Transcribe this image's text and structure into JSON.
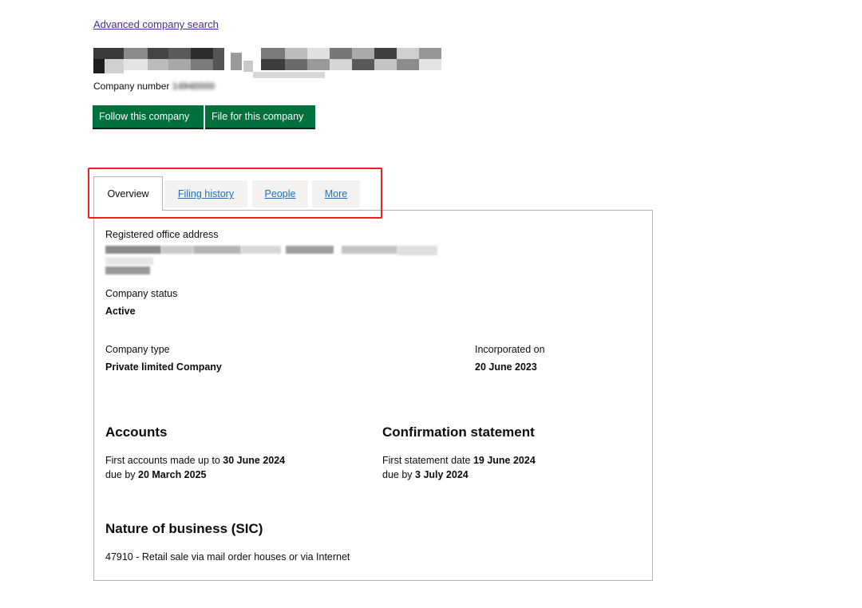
{
  "header": {
    "advanced_search_link": "Advanced company search",
    "company_number_label": "Company number",
    "company_number_value": "14940000"
  },
  "actions": {
    "follow_label": "Follow this company",
    "file_label": "File for this company",
    "button_color": "#00703c"
  },
  "tabs": [
    {
      "label": "Overview",
      "selected": true
    },
    {
      "label": "Filing history",
      "selected": false
    },
    {
      "label": "People",
      "selected": false
    },
    {
      "label": "More",
      "selected": false
    }
  ],
  "overview": {
    "registered_office_label": "Registered office address",
    "status_label": "Company status",
    "status_value": "Active",
    "type_label": "Company type",
    "type_value": "Private limited Company",
    "incorporated_label": "Incorporated on",
    "incorporated_value": "20 June 2023",
    "accounts": {
      "heading": "Accounts",
      "line1_prefix": "First accounts made up to ",
      "line1_date": "30 June 2024",
      "line2_prefix": "due by ",
      "line2_date": "20 March 2025"
    },
    "confirmation": {
      "heading": "Confirmation statement",
      "line1_prefix": "First statement date ",
      "line1_date": "19 June 2024",
      "line2_prefix": "due by ",
      "line2_date": "3 July 2024"
    },
    "sic": {
      "heading": "Nature of business (SIC)",
      "entry": "47910 - Retail sale via mail order houses or via Internet"
    }
  },
  "colors": {
    "link": "#1d70b8",
    "visited_link": "#4c2c92",
    "highlight": "#e8211f"
  }
}
